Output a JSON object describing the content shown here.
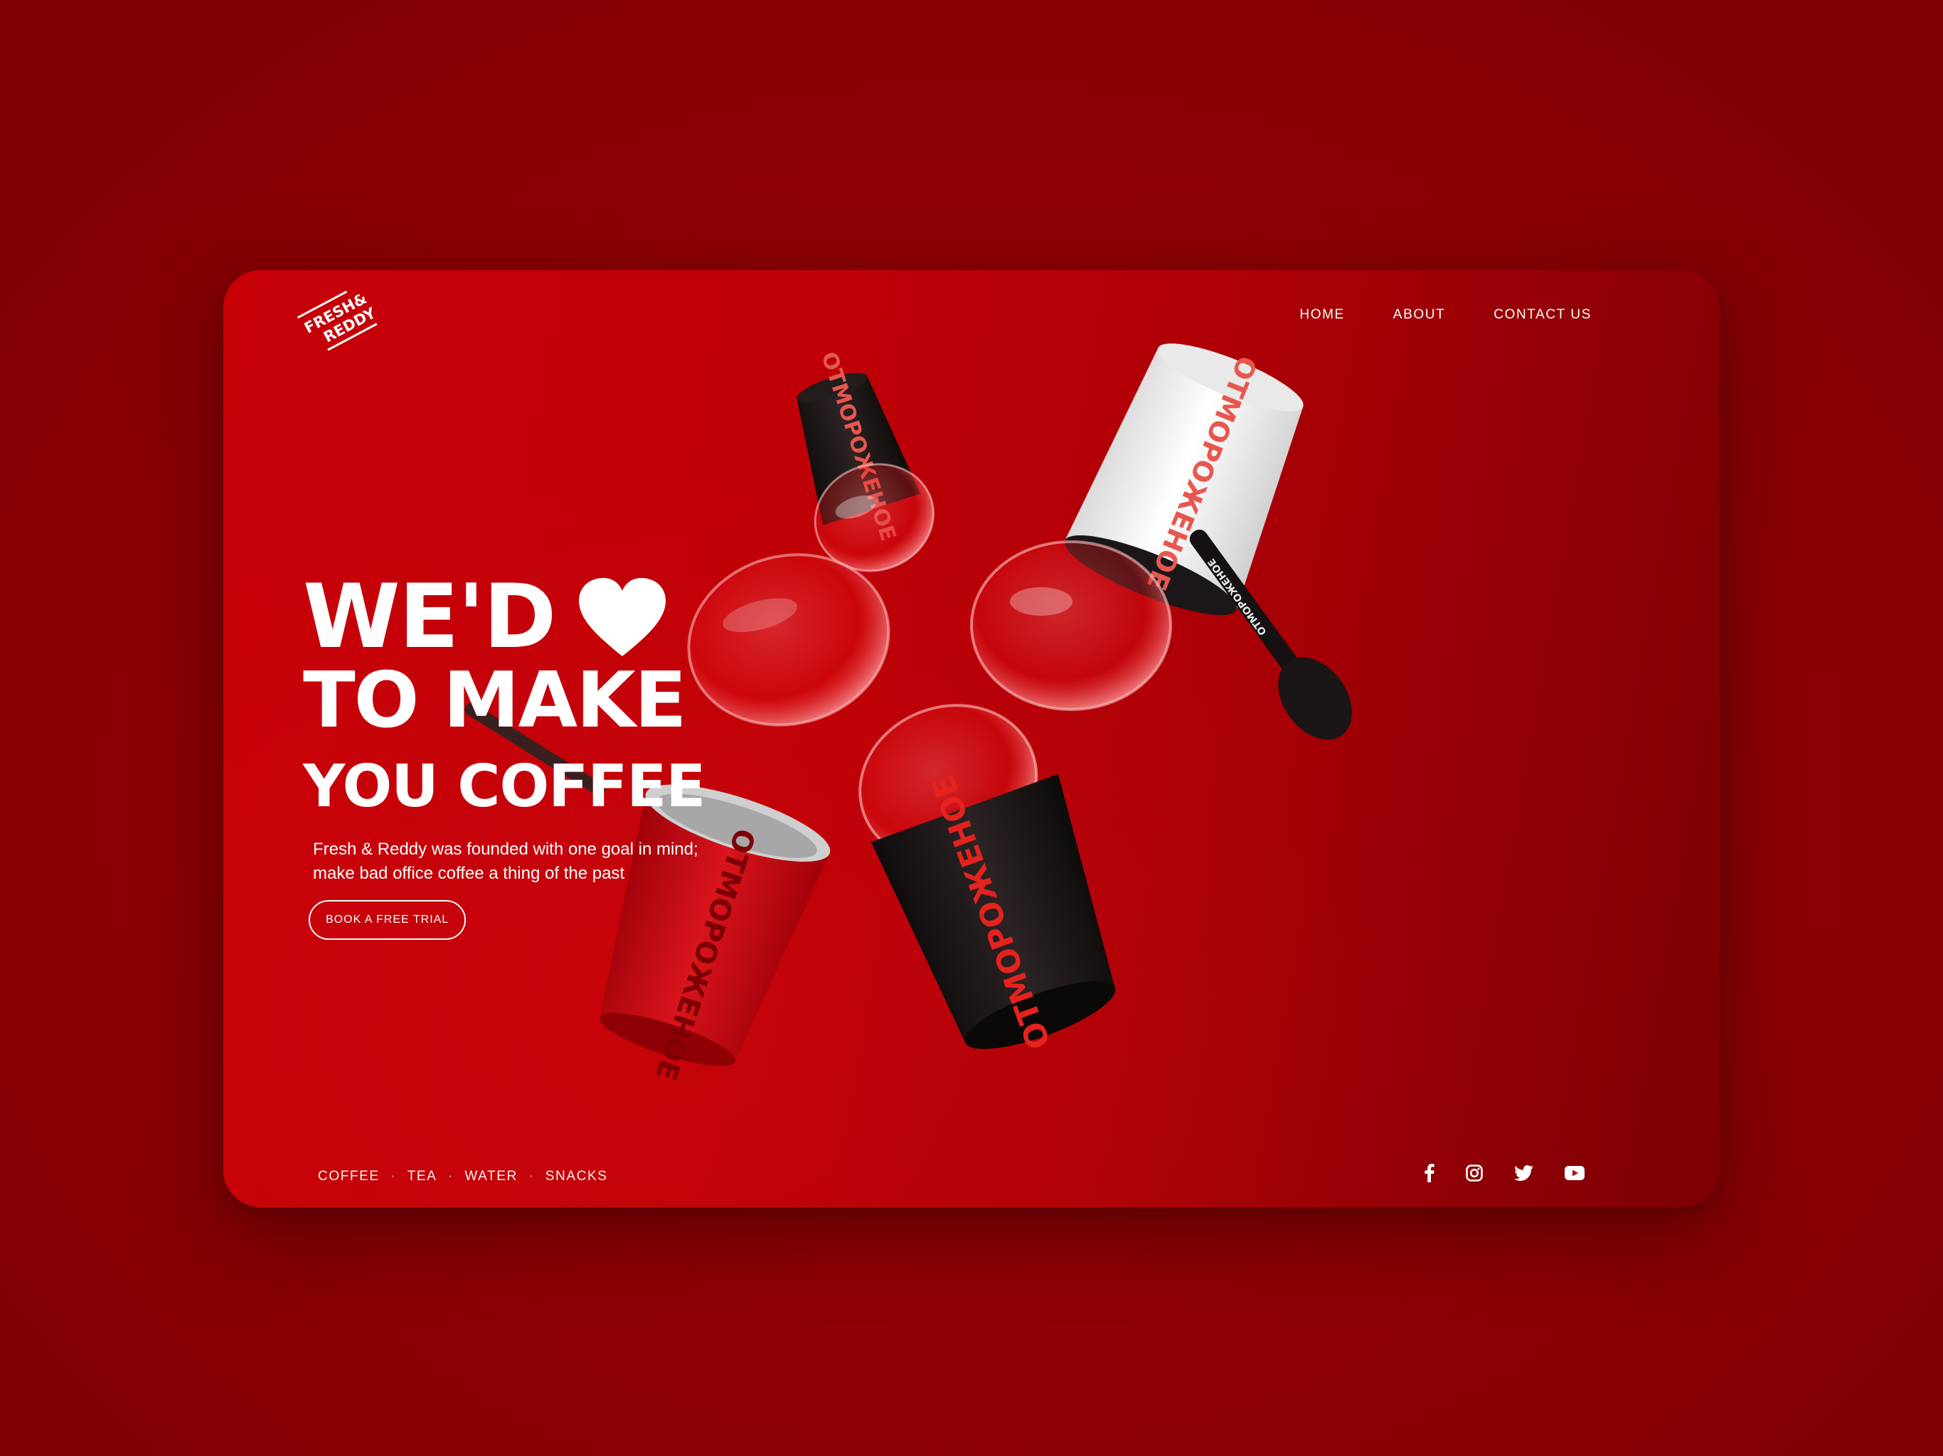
{
  "brand": {
    "logo_text_line1": "FRESH&",
    "logo_text_line2": "REDDY"
  },
  "nav": {
    "items": [
      {
        "label": "HOME"
      },
      {
        "label": "ABOUT"
      },
      {
        "label": "CONTACT US"
      }
    ]
  },
  "hero": {
    "line1": "WE'D",
    "line1_icon": "heart-icon",
    "line2": "TO MAKE",
    "line3": "YOU COFFEE",
    "tagline_line1": "Fresh & Reddy was founded with one goal in mind;",
    "tagline_line2": "make bad office coffee a thing of the past",
    "cta_label": "BOOK A FREE TRIAL"
  },
  "illustration": {
    "cup_text": "ОТМОРОЖЕНОЕ",
    "spoon_text": "ОТМОРОЖЕНОЕ"
  },
  "footer": {
    "categories": [
      {
        "label": "COFFEE"
      },
      {
        "label": "TEA"
      },
      {
        "label": "WATER"
      },
      {
        "label": "SNACKS"
      }
    ],
    "separator": "·",
    "social": [
      {
        "icon": "facebook-icon"
      },
      {
        "icon": "instagram-icon"
      },
      {
        "icon": "twitter-icon"
      },
      {
        "icon": "youtube-icon"
      }
    ]
  },
  "colors": {
    "page_background": "#8a0005",
    "card_red": "#c70008",
    "text": "#ffffff",
    "cup_black": "#1a1516",
    "cup_accent": "#e8574f"
  }
}
